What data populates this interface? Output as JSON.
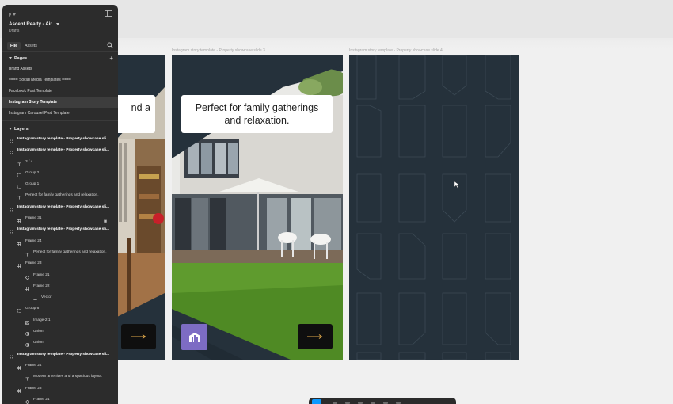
{
  "app": {
    "project_name": "Ascent Realty - Air",
    "project_location": "Drafts",
    "tabs": [
      {
        "label": "File",
        "active": true
      },
      {
        "label": "Assets",
        "active": false
      }
    ],
    "accent_color": "#0d99ff"
  },
  "pages": {
    "title": "Pages",
    "items": [
      {
        "label": "Brand Assets",
        "active": false
      },
      {
        "label": "==== Social Media Templates ====",
        "active": false
      },
      {
        "label": "Facebook Post Template",
        "active": false
      },
      {
        "label": "Instagram Story Template",
        "active": true
      },
      {
        "label": "Instagram Carousel Post Template",
        "active": false
      }
    ]
  },
  "layers": {
    "title": "Layers",
    "items": [
      {
        "label": "Instagram story template - Property showcase sli...",
        "icon": "grid-icon",
        "depth": 0,
        "bold": true
      },
      {
        "label": "Instagram story template - Property showcase sli...",
        "icon": "grid-icon",
        "depth": 0,
        "bold": true
      },
      {
        "label": "3 / 4",
        "icon": "text-icon",
        "depth": 1,
        "bold": false
      },
      {
        "label": "Group 2",
        "icon": "group-icon",
        "depth": 1,
        "bold": false
      },
      {
        "label": "Group 1",
        "icon": "group-icon",
        "depth": 1,
        "bold": false
      },
      {
        "label": "Perfect for family gatherings and relaxation.",
        "icon": "text-icon",
        "depth": 1,
        "bold": false
      },
      {
        "label": "Instagram story template - Property showcase sli...",
        "icon": "grid-icon",
        "depth": 0,
        "bold": true
      },
      {
        "label": "Frame 31",
        "icon": "frame-icon",
        "depth": 1,
        "bold": false,
        "locked": true
      },
      {
        "label": "Instagram story template - Property showcase sli...",
        "icon": "grid-icon",
        "depth": 0,
        "bold": true
      },
      {
        "label": "Frame 24",
        "icon": "frame-icon",
        "depth": 1,
        "bold": false
      },
      {
        "label": "Perfect for family gatherings and relaxation.",
        "icon": "text-icon",
        "depth": 2,
        "bold": false
      },
      {
        "label": "Frame 23",
        "icon": "frame-icon",
        "depth": 1,
        "bold": false
      },
      {
        "label": "Frame 21",
        "icon": "component-icon",
        "depth": 2,
        "bold": false
      },
      {
        "label": "Frame 22",
        "icon": "frame-icon",
        "depth": 2,
        "bold": false
      },
      {
        "label": "Vector",
        "icon": "vector-icon",
        "depth": 3,
        "bold": false
      },
      {
        "label": "Group 6",
        "icon": "group-icon",
        "depth": 1,
        "bold": false
      },
      {
        "label": "Image-2 1",
        "icon": "image-icon",
        "depth": 2,
        "bold": false
      },
      {
        "label": "Union",
        "icon": "boolean-icon",
        "depth": 2,
        "bold": false
      },
      {
        "label": "Union",
        "icon": "boolean-icon",
        "depth": 2,
        "bold": false
      },
      {
        "label": "Instagram story template - Property showcase sli...",
        "icon": "grid-icon",
        "depth": 0,
        "bold": true
      },
      {
        "label": "Frame 24",
        "icon": "frame-icon",
        "depth": 1,
        "bold": false
      },
      {
        "label": "Modern amenities and a spacious layout.",
        "icon": "text-icon",
        "depth": 2,
        "bold": false
      },
      {
        "label": "Frame 23",
        "icon": "frame-icon",
        "depth": 1,
        "bold": false
      },
      {
        "label": "Frame 21",
        "icon": "component-icon",
        "depth": 2,
        "bold": false
      }
    ]
  },
  "canvas": {
    "frame_labels": [
      "Instagram story template - Property showcase slide 3",
      "Instagram story template - Property showcase slide 4"
    ],
    "slide1_text": "nd a",
    "slide2_text_line1": "Perfect for family gatherings",
    "slide2_text_line2": "and relaxation.",
    "slide_bg_color": "#25313b",
    "logo_color": "#7d6cc4"
  }
}
